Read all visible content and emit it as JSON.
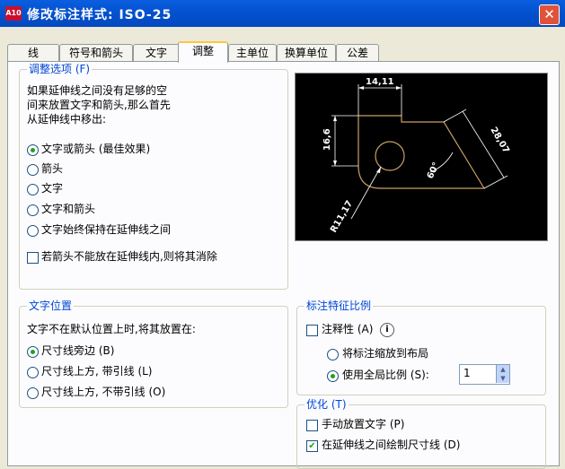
{
  "window": {
    "title": "修改标注样式: ISO-25",
    "app_icon_text": "A10"
  },
  "tabs": [
    "线",
    "符号和箭头",
    "文字",
    "调整",
    "主单位",
    "换算单位",
    "公差"
  ],
  "fit_options": {
    "legend": "调整选项 (F)",
    "description": [
      "如果延伸线之间没有足够的空",
      "间来放置文字和箭头,那么首先",
      "从延伸线中移出:"
    ],
    "radios": [
      "文字或箭头 (最佳效果)",
      "箭头",
      "文字",
      "文字和箭头",
      "文字始终保持在延伸线之间"
    ],
    "selected": 0,
    "suppress_checkbox": "若箭头不能放在延伸线内,则将其消除"
  },
  "preview": {
    "dims": [
      "14,11",
      "16,6",
      "28,07",
      "60°",
      "R11,17"
    ]
  },
  "text_placement": {
    "legend": "文字位置",
    "description": "文字不在默认位置上时,将其放置在:",
    "radios": [
      "尺寸线旁边 (B)",
      "尺寸线上方, 带引线 (L)",
      "尺寸线上方, 不带引线 (O)"
    ],
    "selected": 0
  },
  "scale": {
    "legend": "标注特征比例",
    "annotative": "注释性 (A)",
    "radios": [
      "将标注缩放到布局",
      "使用全局比例 (S):"
    ],
    "selected": 1,
    "global_scale": "1"
  },
  "fine_tuning": {
    "legend": "优化 (T)",
    "checks": [
      "手动放置文字 (P)",
      "在延伸线之间绘制尺寸线 (D)"
    ],
    "checked": [
      false,
      true
    ]
  }
}
